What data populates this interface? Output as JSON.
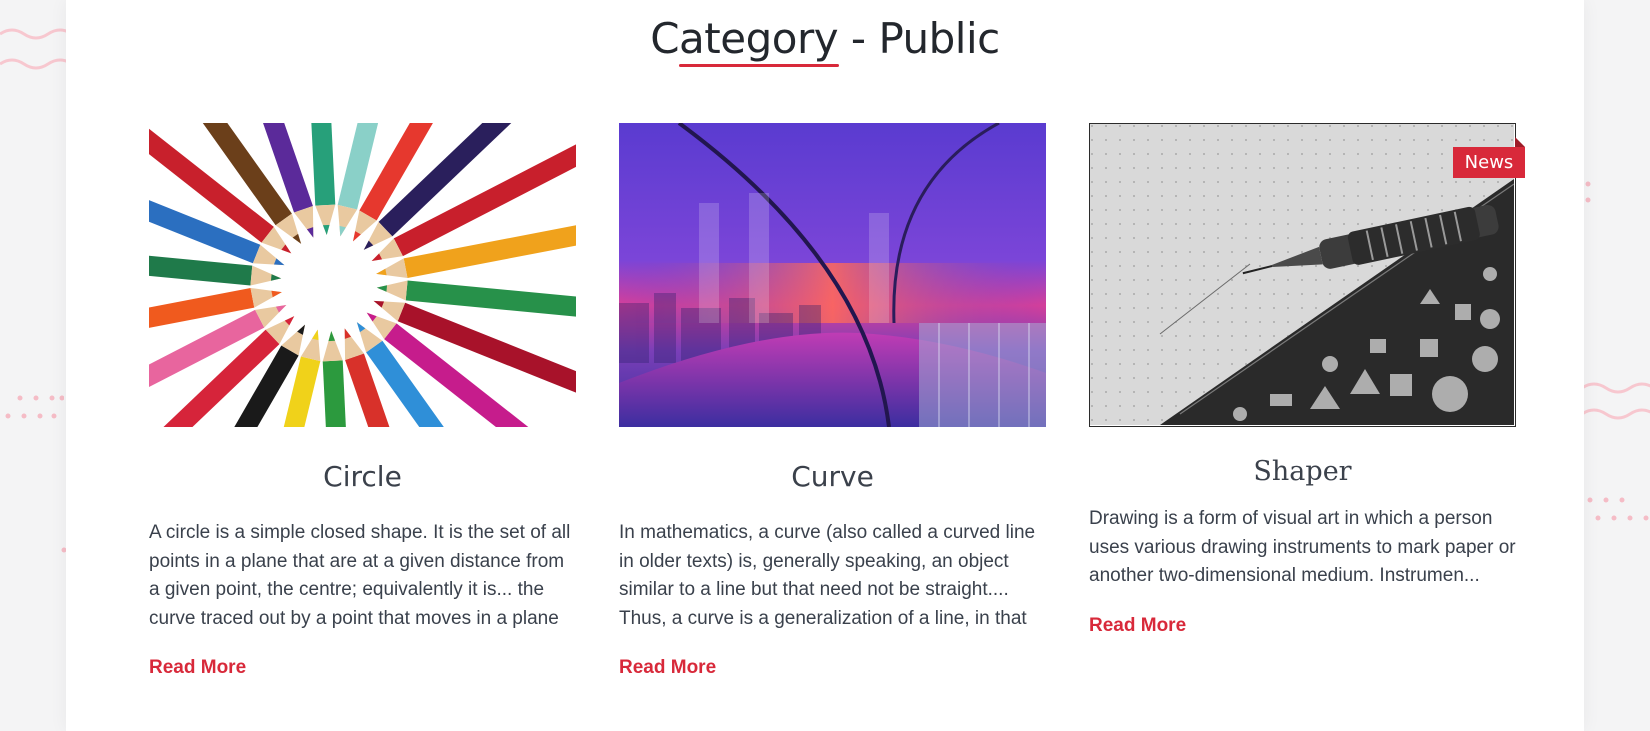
{
  "page": {
    "title": "Category - Public",
    "accent_color": "#d8293a"
  },
  "posts": [
    {
      "title": "Circle",
      "excerpt": "A circle is a simple closed shape. It is the set of all points in a plane that are at a given distance from a given point, the centre; equivalently it is... the curve traced out by a point that moves in a plane so that its distance from a given point is constant.",
      "read_more": "Read More",
      "image_icon": "colored-pencils-circle-image"
    },
    {
      "title": "Curve",
      "excerpt": "In mathematics, a curve (also called a curved line in older texts) is, generally speaking, an object similar to a line but that need not be straight.... Thus, a curve is a generalization of a line, in that its curvature need not be zero.",
      "read_more": "Read More",
      "image_icon": "rainbow-corridor-image"
    },
    {
      "title": "Shaper",
      "excerpt": "Drawing is a form of visual art in which a person uses various drawing instruments to mark paper or another two-dimensional medium. Instrumen...",
      "read_more": "Read More",
      "badge": "News",
      "image_icon": "technical-pen-stencil-image"
    }
  ]
}
